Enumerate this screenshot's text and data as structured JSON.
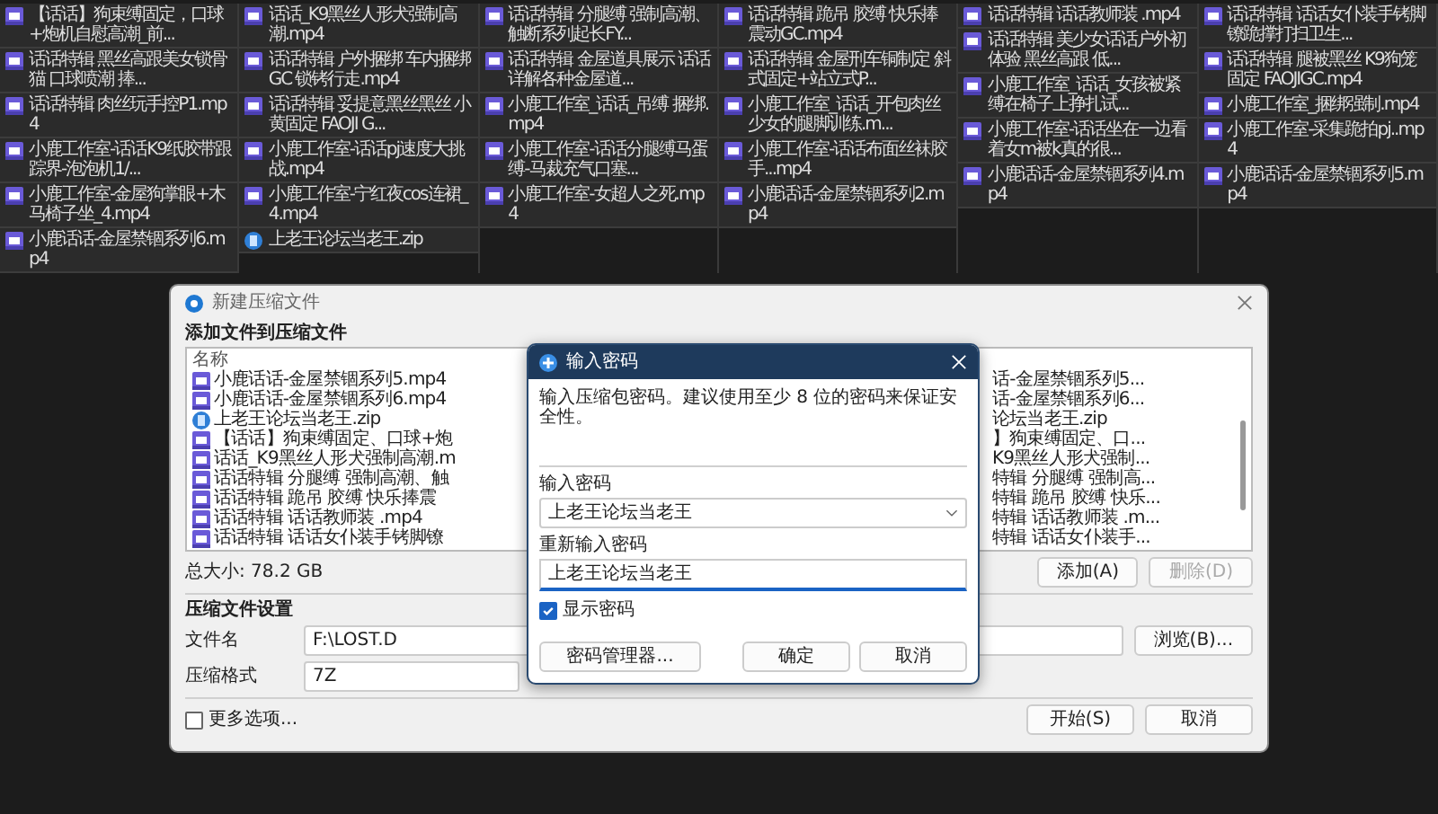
{
  "file_grid": {
    "columns": [
      {
        "items": [
          {
            "name": "【话话】狗束缚固定，口球+炮机自慰高潮_前...",
            "kind": "video"
          },
          {
            "name": "话话特辑 黑丝高跟美女锁骨猫 口球喷潮 捧...",
            "kind": "video"
          },
          {
            "name": "话话特辑 肉丝玩手控P1.mp4",
            "kind": "video"
          },
          {
            "name": "小鹿工作室-话话K9纸胶带跟踪界-泡泡机1/...",
            "kind": "video"
          },
          {
            "name": "小鹿工作室-金屋狗掌眼+木马椅子坐_4.mp4",
            "kind": "video"
          },
          {
            "name": "小鹿话话-金屋禁锢系列6.mp4",
            "kind": "video"
          }
        ]
      },
      {
        "items": [
          {
            "name": "话话_K9黑丝人形犬强制高潮.mp4",
            "kind": "video"
          },
          {
            "name": "话话特辑 户外捆绑 车内捆绑GC 锁铐行走.mp4",
            "kind": "video"
          },
          {
            "name": "话话特辑 妥提意黑丝黑丝 小黄固定 FAOJI G...",
            "kind": "video"
          },
          {
            "name": "小鹿工作室-话话pj速度大挑战.mp4",
            "kind": "video"
          },
          {
            "name": "小鹿工作室-宁红夜cos连裙_4.mp4",
            "kind": "video"
          },
          {
            "name": "上老王论坛当老王.zip",
            "kind": "archive"
          }
        ]
      },
      {
        "items": [
          {
            "name": "话话特辑 分腿缚 强制高潮、触断系列起长FY...",
            "kind": "video"
          },
          {
            "name": "话话特辑 金屋道具展示 话话详解各种金屋道...",
            "kind": "video"
          },
          {
            "name": "小鹿工作室_话话_吊缚 捆绑.mp4",
            "kind": "video"
          },
          {
            "name": "小鹿工作室-话话分腿缚马蛋缚-马裁充气口塞...",
            "kind": "video"
          },
          {
            "name": "小鹿工作室-女超人之死.mp4",
            "kind": "video"
          }
        ]
      },
      {
        "items": [
          {
            "name": "话话特辑 跪吊 胶缚 快乐捧震动GC.mp4",
            "kind": "video"
          },
          {
            "name": "话话特辑 金屋刑车铜制定 斜式固定+站立式P...",
            "kind": "video"
          },
          {
            "name": "小鹿工作室_话话_开包肉丝少女的腿脚训练.m...",
            "kind": "video"
          },
          {
            "name": "小鹿工作室-话话布面丝袜胶手...mp4",
            "kind": "video"
          },
          {
            "name": "小鹿话话-金屋禁锢系列2.mp4",
            "kind": "video"
          }
        ]
      },
      {
        "items": [
          {
            "name": "话话特辑 话话教师装 .mp4",
            "kind": "video"
          },
          {
            "name": "话话特辑 美少女话话户外初体验 黑丝高跟 低...",
            "kind": "video"
          },
          {
            "name": "小鹿工作室_话话_女孩被紧缚在椅子上挣扎试...",
            "kind": "video"
          },
          {
            "name": "小鹿工作室-话话坐在一边看着女m被k真的很...",
            "kind": "video"
          },
          {
            "name": "小鹿话话-金屋禁锢系列4.mp4",
            "kind": "video"
          }
        ]
      },
      {
        "items": [
          {
            "name": "话话特辑 话话女仆装手铐脚镣跪撑打扫卫生...",
            "kind": "video"
          },
          {
            "name": "话话特辑 腿被黑丝 K9狗笼固定 FAOJIGC.mp4",
            "kind": "video"
          },
          {
            "name": "小鹿工作室_捆绑强制.mp4",
            "kind": "video"
          },
          {
            "name": "小鹿工作室-采集跪拍pj..mp4",
            "kind": "video"
          },
          {
            "name": "小鹿话话-金屋禁锢系列5.mp4",
            "kind": "video"
          }
        ]
      }
    ]
  },
  "archive_dialog": {
    "title": "新建压缩文件",
    "heading": "添加文件到压缩文件",
    "list": {
      "header": "名称",
      "rows": [
        {
          "name": "小鹿话话-金屋禁锢系列5.mp4",
          "column_2": "话-金屋禁锢系列5...",
          "kind": "video"
        },
        {
          "name": "小鹿话话-金屋禁锢系列6.mp4",
          "column_2": "话-金屋禁锢系列6...",
          "kind": "video"
        },
        {
          "name": "上老王论坛当老王.zip",
          "column_2": "论坛当老王.zip",
          "kind": "archive"
        },
        {
          "name": "【话话】狗束缚固定、口球+炮",
          "column_2": "】狗束缚固定、口...",
          "kind": "video"
        },
        {
          "name": "话话_K9黑丝人形犬强制高潮.m",
          "column_2": "K9黑丝人形犬强制...",
          "kind": "video"
        },
        {
          "name": "话话特辑 分腿缚 强制高潮、触",
          "column_2": "特辑 分腿缚 强制高...",
          "kind": "video"
        },
        {
          "name": "话话特辑 跪吊 胶缚 快乐捧震",
          "column_2": "特辑 跪吊 胶缚 快乐...",
          "kind": "video"
        },
        {
          "name": "话话特辑 话话教师装 .mp4",
          "column_2": "特辑 话话教师装 .m...",
          "kind": "video"
        },
        {
          "name": "话话特辑 话话女仆装手铐脚镣",
          "column_2": "特辑 话话女仆装手...",
          "kind": "video"
        }
      ]
    },
    "total_size": "总大小: 78.2 GB",
    "add_button": {
      "label": "添加(A)",
      "disabled": false
    },
    "delete_button": {
      "label": "删除(D)",
      "disabled": true
    },
    "settings_heading": "压缩文件设置",
    "filename": {
      "label": "文件名",
      "value": "F:\\LOST.D"
    },
    "browse_button": "浏览(B)...",
    "format": {
      "label": "压缩格式",
      "value": "7Z"
    },
    "more_options": {
      "label": "更多选项...",
      "checked": false
    },
    "start_button": "开始(S)",
    "cancel_button": "取消"
  },
  "password_dialog": {
    "title": "输入密码",
    "prompt": "输入压缩包密码。建议使用至少 8 位的密码来保证安全性。",
    "password_label": "输入密码",
    "password_value": "上老王论坛当老王",
    "confirm_label": "重新输入密码",
    "confirm_value": "上老王论坛当老王",
    "show_password": {
      "label": "显示密码",
      "checked": true
    },
    "manager_button": "密码管理器...",
    "ok_button": "确定",
    "cancel_button": "取消"
  }
}
